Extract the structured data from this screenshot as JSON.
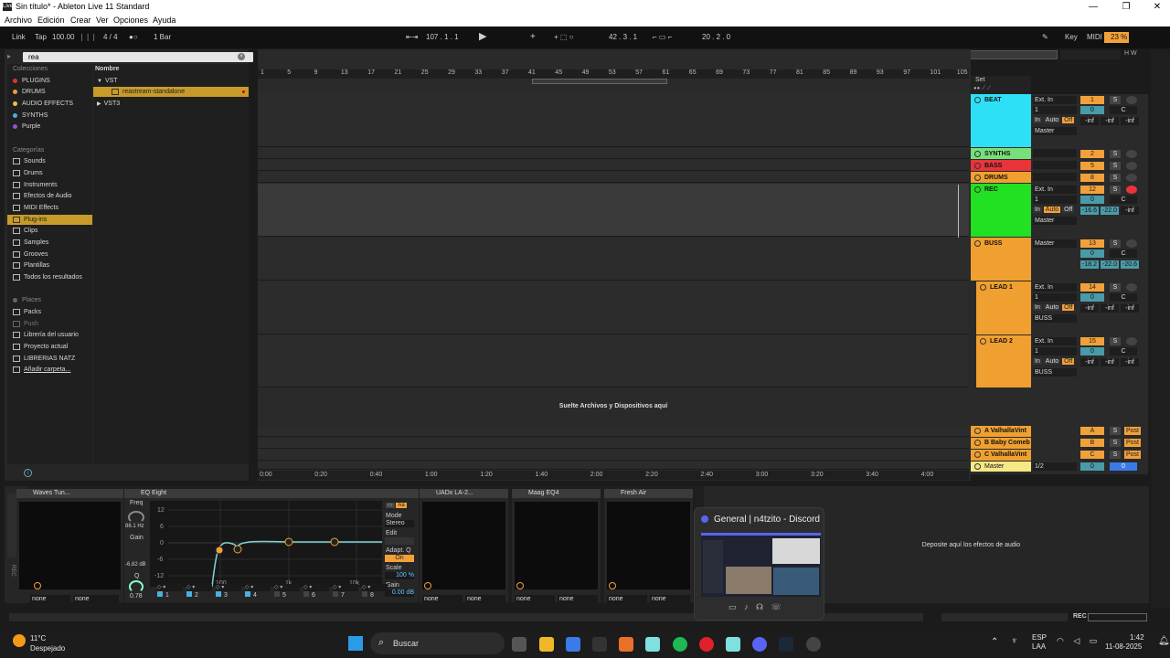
{
  "window": {
    "title": "Sin título* - Ableton Live 11 Standard",
    "logo": "Live",
    "controls": [
      "—",
      "❐",
      "✕"
    ]
  },
  "menu": [
    "Archivo",
    "Edición",
    "Crear",
    "Ver",
    "Opciones",
    "Ayuda"
  ],
  "control": {
    "link": "Link",
    "tap": "Tap",
    "bpm": "100.00",
    "sig": "4 / 4",
    "bar": "1 Bar",
    "position": "107 .  1 .  1",
    "pos2": "42 .  3 .  1",
    "pos3": "20 .  2 .  0",
    "key": "Key",
    "midi": "MIDI",
    "cpu": "23 %"
  },
  "browser": {
    "search": "rea",
    "col_header": "Colecciones",
    "collections": [
      {
        "label": "PLUGINS",
        "color": "#e0332e"
      },
      {
        "label": "DRUMS",
        "color": "#f0a030"
      },
      {
        "label": "AUDIO EFFECTS",
        "color": "#f0c040"
      },
      {
        "label": "SYNTHS",
        "color": "#4ab0e0"
      },
      {
        "label": "Purple",
        "color": "#8a5ad0"
      }
    ],
    "cat_header": "Categorías",
    "categories": [
      "Sounds",
      "Drums",
      "Instruments",
      "Efectos de Audio",
      "MIDI Effects",
      "Plug-ins",
      "Clips",
      "Samples",
      "Grooves",
      "Plantillas",
      "Todos los resultados"
    ],
    "places_header": "Places",
    "places": [
      "Packs",
      "Push",
      "Librería del usuario",
      "Proyecto actual",
      "LIBRERIAS NATZ",
      "Añadir carpeta..."
    ],
    "name_header": "Nombre",
    "results": [
      "VST",
      "reastream-standalone",
      "VST3"
    ]
  },
  "ruler": [
    "1",
    "5",
    "9",
    "13",
    "17",
    "21",
    "25",
    "29",
    "33",
    "37",
    "41",
    "45",
    "49",
    "53",
    "57",
    "61",
    "65",
    "69",
    "73",
    "77",
    "81",
    "85",
    "89",
    "93",
    "97",
    "101",
    "105"
  ],
  "time": [
    "0:00",
    "0:20",
    "0:40",
    "1:00",
    "1:20",
    "1:40",
    "2:00",
    "2:20",
    "2:40",
    "3:00",
    "3:20",
    "3:40",
    "4:00"
  ],
  "drop_files": "Suelte Archivos y Dispositivos aquí",
  "set_label": "Set",
  "tracks": [
    {
      "name": "BEAT",
      "color": "#2ee0f5",
      "num": "1",
      "input": "Ext. In",
      "ch": "1",
      "mon": [
        "In",
        "Auto",
        "Off"
      ],
      "out": "Master",
      "db": [
        "-inf",
        "-inf",
        "-inf"
      ],
      "pan": "C"
    },
    {
      "name": "SYNTHS",
      "color": "#78e07a",
      "num": "2"
    },
    {
      "name": "BASS",
      "color": "#e8343a",
      "num": "5"
    },
    {
      "name": "DRUMS",
      "color": "#f0a030",
      "num": "8"
    },
    {
      "name": "REC",
      "color": "#22e022",
      "num": "12",
      "input": "Ext. In",
      "ch": "1",
      "mon": [
        "In",
        "Auto",
        "Off"
      ],
      "out": "Master",
      "db": [
        "-16.6",
        "-22.0",
        "-inf"
      ],
      "pan": "C"
    },
    {
      "name": "BUSS",
      "color": "#f0a030",
      "num": "13",
      "out": "Master",
      "db": [
        "-18.2",
        "-22.0",
        "-20.6"
      ],
      "pan": "C"
    },
    {
      "name": "LEAD 1",
      "color": "#f0a030",
      "num": "14",
      "input": "Ext. In",
      "ch": "1",
      "mon": [
        "In",
        "Auto",
        "Off"
      ],
      "out": "BUSS",
      "db": [
        "-inf",
        "-inf",
        "-inf"
      ],
      "pan": "C"
    },
    {
      "name": "LEAD 2",
      "color": "#f0a030",
      "num": "15",
      "input": "Ext. In",
      "ch": "1",
      "mon": [
        "In",
        "Auto",
        "Off"
      ],
      "out": "BUSS",
      "db": [
        "-inf",
        "-inf",
        "-inf"
      ],
      "pan": "C"
    }
  ],
  "returns": [
    {
      "name": "A ValhallaVint",
      "letter": "A"
    },
    {
      "name": "B Baby Comeb",
      "letter": "B"
    },
    {
      "name": "C ValhallaVint",
      "letter": "C"
    }
  ],
  "master": {
    "name": "Master",
    "sel": "1/2",
    "vol": "0",
    "pan": "0"
  },
  "post": "Post",
  "solo": "S",
  "devices": {
    "waves": "Waves Tun...",
    "eq": "EQ Eight",
    "uad": "UADx LA-2...",
    "maag": "Maag EQ4",
    "fresh": "Fresh Air",
    "freq_label": "Freq",
    "freq": "86.1 Hz",
    "gain_label": "Gain",
    "gain": "-6.82 dB",
    "q_label": "Q",
    "q": "0.78",
    "eq_y": [
      "12",
      "6",
      "0",
      "-6",
      "-12"
    ],
    "eq_x": [
      "100",
      "1k",
      "10k"
    ],
    "mode_label": "Mode",
    "mode": "Stereo",
    "edit_label": "Edit",
    "adapt_label": "Adapt. Q",
    "adapt": "On",
    "scale_label": "Scale",
    "scale": "100 %",
    "gain2_label": "Gain",
    "gain2": "0.00 dB",
    "bands": [
      "1",
      "2",
      "3",
      "4",
      "5",
      "6",
      "7",
      "8"
    ],
    "none": "none",
    "drop_audio": "Deposite aquí los efectos de audio"
  },
  "discord": {
    "title": "General | n4tzito - Discord"
  },
  "status": {
    "rec": "REC"
  },
  "taskbar": {
    "temp": "11°C",
    "weather": "Despejado",
    "search": "Buscar",
    "lang1": "ESP",
    "lang2": "LAA",
    "time": "1:42",
    "date": "11-08-2025"
  }
}
